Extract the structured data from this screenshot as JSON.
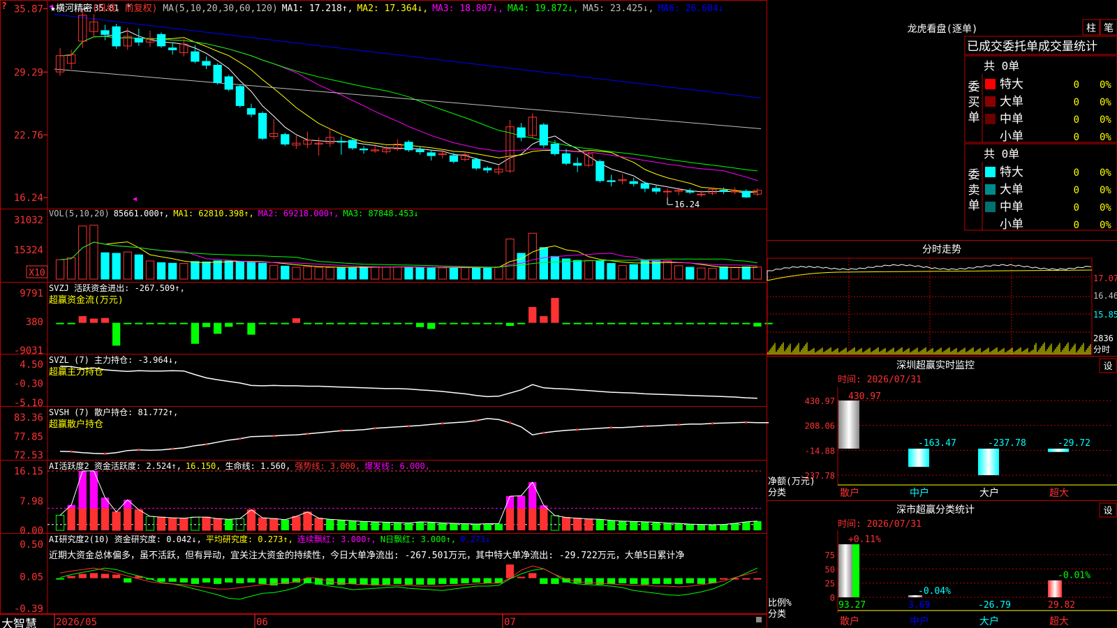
{
  "app": {
    "brand": "大智慧",
    "corner_mark": "?",
    "stock_title": "★横河精密",
    "period": "(日线，前复权)"
  },
  "colors": {
    "up": "#ff3232",
    "down": "#00ffff",
    "grid": "#a00000",
    "frame": "#c00000",
    "ma1": "#ffffff",
    "ma2": "#ffff00",
    "ma3": "#ff00ff",
    "ma4": "#00ff00",
    "ma5": "#c0c0c0",
    "ma6": "#0000ff"
  },
  "price_panel": {
    "ma_header": [
      {
        "text": "MA(5,10,20,30,60,120)",
        "color": "#c0c0c0"
      },
      {
        "text": "MA1: 17.218↑,",
        "color": "#ffffff"
      },
      {
        "text": "MA2: 17.364↓,",
        "color": "#ffff00"
      },
      {
        "text": "MA3: 18.807↓,",
        "color": "#ff00ff"
      },
      {
        "text": "MA4: 19.872↓,",
        "color": "#00ff00"
      },
      {
        "text": "MA5: 23.425↓,",
        "color": "#c0c0c0"
      },
      {
        "text": "MA6: 26.604↓",
        "color": "#0000ff"
      }
    ],
    "y_ticks": [
      "35.87",
      "29.29",
      "22.76",
      "16.24"
    ],
    "high_label": "35.81",
    "low_label": "16.24"
  },
  "vol_panel": {
    "header": [
      {
        "text": "VOL(5,10,20)",
        "color": "#c0c0c0"
      },
      {
        "text": "85661.000↑,",
        "color": "#ffffff"
      },
      {
        "text": "MA1: 62810.398↑,",
        "color": "#ffff00"
      },
      {
        "text": "MA2: 69218.000↑,",
        "color": "#ff00ff"
      },
      {
        "text": "MA3: 87848.453↓",
        "color": "#00ff00"
      }
    ],
    "y_ticks": [
      "31032",
      "15324"
    ],
    "unit": "X10"
  },
  "svzj_panel": {
    "header": [
      {
        "text": "SVZJ  活跃资金进出: -267.509↑,",
        "color": "#ffffff"
      }
    ],
    "sub": "超赢资金流(万元)",
    "y_ticks": [
      "9791",
      "380",
      "-9031"
    ]
  },
  "svzl_panel": {
    "header": [
      {
        "text": "SVZL (7) 主力持仓: -3.964↓,",
        "color": "#ffffff"
      }
    ],
    "sub": "超赢主力持仓",
    "y_ticks": [
      "4.50",
      "-0.30",
      "-5.10"
    ]
  },
  "svsh_panel": {
    "header": [
      {
        "text": "SVSH (7) 散户持仓: 81.772↑,",
        "color": "#ffffff"
      }
    ],
    "sub": "超赢散户持仓",
    "y_ticks": [
      "83.36",
      "77.85",
      "72.53"
    ]
  },
  "ai1_panel": {
    "header": [
      {
        "text": "AI活跃度2 资金活跃度: 2.524↑,",
        "color": "#ffffff"
      },
      {
        "text": "16.150,",
        "color": "#ffff00"
      },
      {
        "text": "生命线: 1.560,",
        "color": "#ffffff"
      },
      {
        "text": "强势线: 3.000,",
        "color": "#ff3232"
      },
      {
        "text": "爆发线: 6.000,",
        "color": "#ff00ff"
      }
    ],
    "y_ticks": [
      "16.15",
      "7.98",
      "0.00"
    ]
  },
  "ai2_panel": {
    "header": [
      {
        "text": "AI研究度2(10) 资金研究度: 0.042↓,",
        "color": "#ffffff"
      },
      {
        "text": "平均研究度: 0.273↑,",
        "color": "#ffff00"
      },
      {
        "text": "连续飘红: 3.000↑,",
        "color": "#ff00ff"
      },
      {
        "text": "N日飘红: 3.000↑,",
        "color": "#00ff00"
      },
      {
        "text": "0.273↓",
        "color": "#0000ff"
      }
    ],
    "note": "近期大资金总体偏多，虽不活跃，但有异动，宜关注大资金的持续性，今日大单净流出: -267.501万元，其中特大单净流出: -29.722万元，大单5日累计净",
    "y_ticks": [
      "0.50",
      "0.05",
      "-0.39"
    ]
  },
  "x_axis": {
    "labels": [
      "2026/05",
      "06",
      "07"
    ]
  },
  "longhu": {
    "title": "龙虎看盘(逐单)",
    "btn_bar": "柱",
    "btn_detail": "笔",
    "tabs": [
      "已成交",
      "委托单",
      "成交量统计"
    ],
    "buy": {
      "side_label": "委买单",
      "total": "共 0单",
      "rows": [
        {
          "label": "特大",
          "count": "0",
          "pct": "0%",
          "color": "#ff0000"
        },
        {
          "label": "大单",
          "count": "0",
          "pct": "0%",
          "color": "#8b0000"
        },
        {
          "label": "中单",
          "count": "0",
          "pct": "0%",
          "color": "#6b0000"
        },
        {
          "label": "小单",
          "count": "0",
          "pct": "0%",
          "color": ""
        }
      ]
    },
    "sell": {
      "side_label": "委卖单",
      "total": "共 0单",
      "rows": [
        {
          "label": "特大",
          "count": "0",
          "pct": "0%",
          "color": "#00ffff"
        },
        {
          "label": "大单",
          "count": "0",
          "pct": "0%",
          "color": "#008b8b"
        },
        {
          "label": "中单",
          "count": "0",
          "pct": "0%",
          "color": "#007070"
        },
        {
          "label": "小单",
          "count": "0",
          "pct": "0%",
          "color": ""
        }
      ]
    }
  },
  "minute": {
    "title": "分时走势",
    "price_ticks": [
      "17.07",
      "16.46",
      "15.85"
    ],
    "vol_tick": "2836",
    "unit": "分时"
  },
  "sz_monitor": {
    "title": "深圳超赢实时监控",
    "btn": "设",
    "time_label": "时间: 2026/07/31",
    "y_ticks": [
      "430.97",
      "208.06",
      "-14.88",
      "-237.78"
    ],
    "axis_label_1": "净额(万元)",
    "axis_label_2": "分类",
    "categories": [
      "散户",
      "中户",
      "大户",
      "超大"
    ],
    "values": [
      430.97,
      -163.47,
      -237.78,
      -29.72
    ],
    "value_labels": [
      "430.97",
      "-163.47",
      "-237.78",
      "-29.72"
    ]
  },
  "sz_class": {
    "title": "深市超赢分类统计",
    "btn": "设",
    "time_label": "时间: 2026/07/31",
    "y_ticks": [
      "75",
      "50",
      "25",
      "0"
    ],
    "axis_label_1": "比例%",
    "axis_label_2": "分类",
    "categories": [
      "散户",
      "中户",
      "大户",
      "超大"
    ],
    "top_labels": [
      "+0.11%",
      "-0.04%",
      "",
      "-0.01%"
    ],
    "bottom_labels": [
      "93.27",
      "3.69",
      "-26.79",
      "29.82"
    ],
    "values": [
      93.27,
      3.69,
      0,
      29.82
    ]
  },
  "chart_data": [
    {
      "type": "candlestick",
      "title": "横河精密 (日线，前复权)",
      "ylim": [
        16.24,
        35.87
      ],
      "candles": [
        {
          "o": 29.3,
          "c": 31.0,
          "h": 31.8,
          "l": 28.9
        },
        {
          "o": 30.2,
          "c": 31.1,
          "h": 31.6,
          "l": 29.6
        },
        {
          "o": 32.5,
          "c": 35.2,
          "h": 35.9,
          "l": 31.8
        },
        {
          "o": 33.5,
          "c": 34.5,
          "h": 35.3,
          "l": 32.9
        },
        {
          "o": 33.6,
          "c": 33.2,
          "h": 34.2,
          "l": 32.6
        },
        {
          "o": 34.0,
          "c": 32.0,
          "h": 34.3,
          "l": 31.7
        },
        {
          "o": 32.0,
          "c": 33.0,
          "h": 33.9,
          "l": 31.6
        },
        {
          "o": 32.8,
          "c": 32.4,
          "h": 33.8,
          "l": 32.0
        },
        {
          "o": 32.4,
          "c": 32.7,
          "h": 33.6,
          "l": 31.9
        },
        {
          "o": 33.2,
          "c": 32.0,
          "h": 33.4,
          "l": 31.8
        },
        {
          "o": 31.8,
          "c": 31.6,
          "h": 32.4,
          "l": 31.1
        },
        {
          "o": 31.3,
          "c": 32.2,
          "h": 32.7,
          "l": 30.9
        },
        {
          "o": 31.4,
          "c": 30.4,
          "h": 32.1,
          "l": 30.2
        },
        {
          "o": 30.4,
          "c": 30.0,
          "h": 30.9,
          "l": 29.6
        },
        {
          "o": 30.0,
          "c": 28.2,
          "h": 30.2,
          "l": 28.0
        },
        {
          "o": 28.8,
          "c": 27.5,
          "h": 29.0,
          "l": 27.3
        },
        {
          "o": 27.8,
          "c": 25.8,
          "h": 28.0,
          "l": 25.6
        },
        {
          "o": 25.5,
          "c": 24.9,
          "h": 26.0,
          "l": 24.6
        },
        {
          "o": 25.0,
          "c": 22.4,
          "h": 25.2,
          "l": 22.2
        },
        {
          "o": 22.6,
          "c": 22.9,
          "h": 24.4,
          "l": 22.3
        },
        {
          "o": 22.8,
          "c": 21.8,
          "h": 23.0,
          "l": 21.6
        },
        {
          "o": 21.7,
          "c": 21.9,
          "h": 22.7,
          "l": 21.3
        },
        {
          "o": 21.8,
          "c": 22.2,
          "h": 23.1,
          "l": 21.4
        },
        {
          "o": 21.8,
          "c": 21.9,
          "h": 22.5,
          "l": 20.6
        },
        {
          "o": 21.9,
          "c": 22.5,
          "h": 23.4,
          "l": 21.5
        },
        {
          "o": 22.1,
          "c": 22.0,
          "h": 22.6,
          "l": 20.7
        },
        {
          "o": 22.2,
          "c": 21.4,
          "h": 22.4,
          "l": 21.2
        },
        {
          "o": 21.3,
          "c": 21.2,
          "h": 21.6,
          "l": 20.8
        },
        {
          "o": 21.1,
          "c": 21.2,
          "h": 21.8,
          "l": 20.9
        },
        {
          "o": 21.0,
          "c": 21.3,
          "h": 21.6,
          "l": 20.8
        },
        {
          "o": 21.3,
          "c": 21.8,
          "h": 22.3,
          "l": 21.1
        },
        {
          "o": 22.0,
          "c": 21.2,
          "h": 22.2,
          "l": 21.0
        },
        {
          "o": 21.2,
          "c": 21.0,
          "h": 21.6,
          "l": 20.7
        },
        {
          "o": 20.9,
          "c": 20.6,
          "h": 21.2,
          "l": 20.1
        },
        {
          "o": 20.7,
          "c": 20.8,
          "h": 21.3,
          "l": 20.3
        },
        {
          "o": 20.6,
          "c": 20.0,
          "h": 20.9,
          "l": 19.8
        },
        {
          "o": 20.2,
          "c": 20.7,
          "h": 21.0,
          "l": 20.0
        },
        {
          "o": 20.2,
          "c": 19.3,
          "h": 20.4,
          "l": 19.1
        },
        {
          "o": 19.3,
          "c": 19.1,
          "h": 19.5,
          "l": 18.8
        },
        {
          "o": 18.9,
          "c": 19.2,
          "h": 19.6,
          "l": 18.6
        },
        {
          "o": 19.0,
          "c": 23.6,
          "h": 24.3,
          "l": 18.8
        },
        {
          "o": 23.5,
          "c": 22.5,
          "h": 24.0,
          "l": 22.1
        },
        {
          "o": 22.7,
          "c": 24.6,
          "h": 25.0,
          "l": 22.4
        },
        {
          "o": 23.8,
          "c": 21.7,
          "h": 24.0,
          "l": 21.4
        },
        {
          "o": 21.8,
          "c": 20.8,
          "h": 22.2,
          "l": 20.6
        },
        {
          "o": 20.8,
          "c": 19.8,
          "h": 21.3,
          "l": 19.6
        },
        {
          "o": 19.8,
          "c": 19.6,
          "h": 20.4,
          "l": 18.9
        },
        {
          "o": 19.6,
          "c": 20.8,
          "h": 21.0,
          "l": 19.4
        },
        {
          "o": 20.0,
          "c": 18.0,
          "h": 20.2,
          "l": 17.8
        },
        {
          "o": 18.0,
          "c": 17.9,
          "h": 18.6,
          "l": 17.4
        },
        {
          "o": 18.0,
          "c": 18.1,
          "h": 18.7,
          "l": 17.6
        },
        {
          "o": 17.9,
          "c": 17.7,
          "h": 18.3,
          "l": 17.4
        },
        {
          "o": 17.7,
          "c": 17.2,
          "h": 17.9,
          "l": 16.8
        },
        {
          "o": 17.2,
          "c": 16.9,
          "h": 17.5,
          "l": 16.6
        },
        {
          "o": 16.9,
          "c": 16.9,
          "h": 17.2,
          "l": 16.24
        },
        {
          "o": 16.9,
          "c": 17.0,
          "h": 17.3,
          "l": 16.5
        },
        {
          "o": 16.9,
          "c": 16.8,
          "h": 17.2,
          "l": 16.6
        },
        {
          "o": 16.6,
          "c": 16.6,
          "h": 17.0,
          "l": 16.3
        },
        {
          "o": 16.7,
          "c": 17.1,
          "h": 17.3,
          "l": 16.5
        },
        {
          "o": 17.0,
          "c": 16.9,
          "h": 17.3,
          "l": 16.6
        },
        {
          "o": 16.9,
          "c": 16.9,
          "h": 17.3,
          "l": 16.6
        },
        {
          "o": 16.9,
          "c": 16.3,
          "h": 17.1,
          "l": 16.2
        },
        {
          "o": 16.6,
          "c": 17.0,
          "h": 17.2,
          "l": 16.4
        }
      ]
    },
    {
      "type": "bar",
      "title": "VOL(5,10,20)",
      "ylim": [
        0,
        31032
      ],
      "values": [
        10200,
        11200,
        27800,
        28200,
        13800,
        13500,
        14200,
        12700,
        9500,
        8600,
        8300,
        8200,
        9200,
        9000,
        9600,
        9500,
        9300,
        8900,
        8300,
        7200,
        6800,
        6200,
        6500,
        6200,
        6100,
        6000,
        6100,
        6500,
        6500,
        6400,
        6400,
        6300,
        6000,
        5800,
        5900,
        6100,
        6200,
        6200,
        6000,
        6400,
        21000,
        13500,
        24000,
        16500,
        11900,
        10600,
        9800,
        9800,
        9600,
        8200,
        7100,
        7600,
        9600,
        9700,
        9600,
        7000,
        6200,
        5800,
        5600,
        6400,
        6200,
        6400,
        6300
      ]
    },
    {
      "type": "bar",
      "title": "SVZJ 活跃资金进出",
      "ylim": [
        -9031,
        9791
      ],
      "values": [
        -200,
        -150,
        2200,
        1400,
        1600,
        -7500,
        -250,
        -450,
        -250,
        -250,
        -250,
        -250,
        -6900,
        -1400,
        -3600,
        -1300,
        -250,
        -3900,
        -100,
        -150,
        -100,
        1500,
        -250,
        -250,
        -250,
        -250,
        -250,
        -250,
        -250,
        -100,
        -250,
        -100,
        -1400,
        -2000,
        -250,
        -200,
        -250,
        -250,
        -250,
        -200,
        -1000,
        -250,
        5200,
        2200,
        8200,
        -250,
        -200,
        -250,
        -250,
        -250,
        -250,
        -250,
        -250,
        -100,
        -250,
        -200,
        -250,
        -100,
        -250,
        -100,
        -250,
        -250,
        -1200,
        -200
      ]
    },
    {
      "type": "line",
      "title": "SVZL 主力持仓",
      "ylim": [
        -5.1,
        4.5
      ],
      "values": [
        4.0,
        3.9,
        3.4,
        3.6,
        3.1,
        2.9,
        2.7,
        2.9,
        2.8,
        2.8,
        2.9,
        2.8,
        1.9,
        1.1,
        0.6,
        0.2,
        -0.2,
        -0.8,
        -0.9,
        -0.8,
        -0.9,
        -0.9,
        -1.0,
        -1.0,
        -1.1,
        -1.2,
        -1.3,
        -1.4,
        -1.5,
        -1.6,
        -1.6,
        -1.7,
        -1.9,
        -2.1,
        -2.3,
        -2.6,
        -2.9,
        -3.3,
        -3.6,
        -3.5,
        -2.7,
        -1.9,
        -0.6,
        -1.4,
        -1.6,
        -1.7,
        -1.9,
        -2.1,
        -2.3,
        -2.5,
        -2.6,
        -2.7,
        -2.9,
        -3.0,
        -3.1,
        -3.2,
        -3.3,
        -3.4,
        -3.5,
        -3.6,
        -3.7,
        -3.9,
        -4.0
      ]
    },
    {
      "type": "line",
      "title": "SVSH 散户持仓",
      "ylim": [
        72.53,
        83.36
      ],
      "values": [
        73.6,
        73.5,
        73.2,
        73.0,
        72.9,
        73.2,
        73.8,
        74.0,
        73.9,
        74.0,
        74.3,
        74.6,
        75.2,
        75.6,
        76.2,
        76.8,
        77.2,
        77.8,
        77.9,
        78.0,
        78.2,
        78.3,
        78.6,
        78.9,
        79.2,
        79.5,
        79.6,
        79.8,
        80.2,
        80.4,
        80.6,
        80.8,
        81.0,
        81.3,
        81.6,
        81.8,
        82.0,
        82.4,
        83.0,
        82.7,
        81.8,
        80.6,
        78.3,
        78.9,
        79.3,
        79.6,
        79.8,
        80.0,
        80.2,
        80.4,
        80.4,
        80.6,
        80.8,
        80.9,
        81.1,
        81.2,
        81.4,
        81.4,
        81.6,
        81.7,
        81.8,
        81.9,
        81.8,
        81.8
      ]
    },
    {
      "type": "bar",
      "title": "AI活跃度2 资金活跃度",
      "ylim": [
        0,
        16.15
      ],
      "values": [
        4.1,
        6.9,
        16.15,
        16.2,
        8.9,
        5.0,
        8.3,
        5.6,
        3.8,
        3.6,
        3.4,
        3.3,
        3.6,
        3.6,
        3.2,
        3.0,
        3.2,
        5.6,
        3.4,
        3.2,
        2.9,
        3.8,
        5.0,
        3.3,
        3.0,
        2.8,
        2.6,
        2.4,
        2.3,
        2.2,
        2.1,
        2.0,
        2.3,
        2.2,
        2.0,
        1.9,
        1.8,
        1.7,
        1.8,
        1.8,
        9.3,
        9.4,
        13.1,
        6.8,
        4.0,
        3.5,
        3.3,
        3.1,
        3.0,
        2.7,
        2.5,
        2.4,
        2.3,
        2.2,
        2.0,
        1.9,
        1.7,
        1.6,
        1.5,
        1.6,
        1.9,
        2.3,
        2.5
      ]
    },
    {
      "type": "bar",
      "title": "AI研究度2(10) 资金研究度",
      "ylim": [
        -0.39,
        0.5
      ],
      "values": [
        0.02,
        0.06,
        0.09,
        0.1,
        0.09,
        0.08,
        -0.03,
        0.06,
        0.02,
        -0.02,
        -0.02,
        -0.03,
        -0.05,
        -0.03,
        -0.05,
        -0.03,
        -0.04,
        -0.03,
        -0.05,
        -0.07,
        -0.05,
        -0.03,
        -0.04,
        -0.06,
        -0.06,
        -0.06,
        -0.05,
        -0.06,
        -0.07,
        -0.06,
        -0.05,
        -0.06,
        -0.06,
        -0.06,
        -0.05,
        -0.05,
        -0.04,
        -0.03,
        -0.04,
        -0.04,
        0.22,
        0.05,
        0.1,
        -0.05,
        -0.05,
        -0.03,
        -0.04,
        -0.05,
        -0.06,
        -0.05,
        -0.04,
        -0.05,
        -0.06,
        -0.05,
        -0.05,
        -0.05,
        -0.04,
        -0.05,
        -0.04,
        0.03,
        0.03,
        0.03,
        0.03
      ]
    },
    {
      "type": "bar",
      "title": "深圳超赢实时监控",
      "categories": [
        "散户",
        "中户",
        "大户",
        "超大"
      ],
      "values": [
        430.97,
        -163.47,
        -237.78,
        -29.72
      ],
      "ylabel": "净额(万元)",
      "ylim": [
        -237.78,
        430.97
      ]
    },
    {
      "type": "bar",
      "title": "深市超赢分类统计",
      "categories": [
        "散户",
        "中户",
        "大户",
        "超大"
      ],
      "values": [
        93.27,
        3.69,
        0,
        29.82
      ],
      "ylabel": "比例%",
      "ylim": [
        0,
        93.27
      ]
    }
  ]
}
